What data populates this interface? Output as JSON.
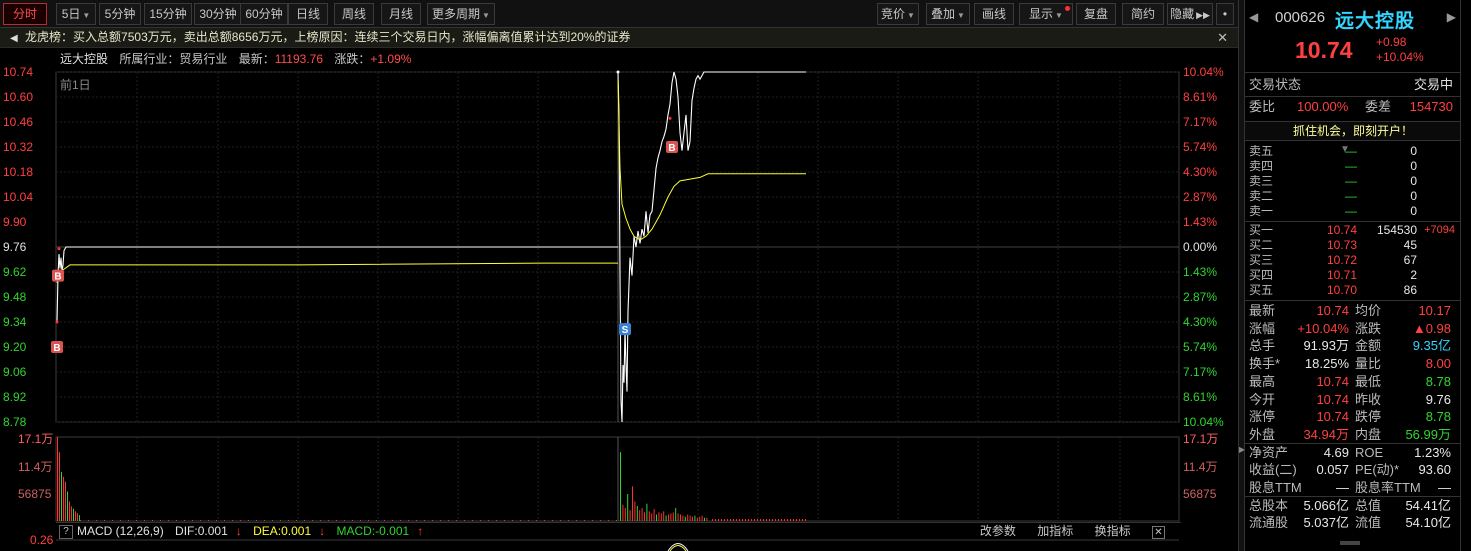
{
  "toolbar": {
    "left": [
      "分时",
      "5日",
      "5分钟",
      "15分钟",
      "30分钟",
      "60分钟",
      "日线",
      "周线",
      "月线",
      "更多周期"
    ],
    "right": [
      "竞价",
      "叠加",
      "画线",
      "显示",
      "复盘",
      "简约",
      "隐藏"
    ]
  },
  "notice": {
    "text": "龙虎榜：买入总额7503万元，卖出总额8656万元，上榜原因：连续三个交易日内，涨幅偏离值累计达到20%的证券",
    "close": "✕"
  },
  "chart_info": {
    "name": "远大控股",
    "industry": "所属行业：贸易行业",
    "latest_label": "最新：",
    "latest": "11193.76",
    "change_label": "涨跌：",
    "change": "+1.09%",
    "prev_label": "前1日"
  },
  "chart_data": {
    "type": "line",
    "price_ticks": [
      "10.74",
      "10.60",
      "10.46",
      "10.32",
      "10.18",
      "10.04",
      "9.90",
      "9.76",
      "9.62",
      "9.48",
      "9.34",
      "9.20",
      "9.06",
      "8.92",
      "8.78"
    ],
    "pct_ticks": [
      "10.04%",
      "8.61%",
      "7.17%",
      "5.74%",
      "4.30%",
      "2.87%",
      "1.43%",
      "0.00%",
      "1.43%",
      "2.87%",
      "4.30%",
      "5.74%",
      "7.17%",
      "8.61%",
      "10.04%"
    ],
    "prev_close": 9.76,
    "ylim": [
      8.78,
      10.74
    ],
    "volume_ticks": [
      "17.1万",
      "11.4万",
      "56875"
    ],
    "macd_tick": "0.26",
    "markers": [
      {
        "label": "B",
        "day": "prev",
        "price": 9.6
      },
      {
        "label": "B",
        "day": "prev",
        "price": 9.2
      },
      {
        "label": "S",
        "day": "today",
        "price": 9.3
      },
      {
        "label": "B",
        "day": "today",
        "price": 10.32
      }
    ],
    "series": [
      {
        "name": "price",
        "color": "#ffffff"
      },
      {
        "name": "avg",
        "color": "#ffff33"
      }
    ]
  },
  "macd": {
    "help": "?",
    "title": "MACD (12,26,9)",
    "dif": "DIF:0.001",
    "dea": "DEA:0.001",
    "macd": "MACD:-0.001",
    "actions": [
      "改参数",
      "加指标",
      "换指标"
    ],
    "close": "✕"
  },
  "panel": {
    "code": "000626",
    "name": "远大控股",
    "price": "10.74",
    "change": "+0.98",
    "change_pct": "+10.04%",
    "status_label": "交易状态",
    "status": "交易中",
    "weibi_label": "委比",
    "weibi": "100.00%",
    "weicha_label": "委差",
    "weicha": "154730",
    "promo": "抓住机会，即刻开户！",
    "sell": [
      {
        "label": "卖五",
        "price": "—",
        "vol": "0"
      },
      {
        "label": "卖四",
        "price": "—",
        "vol": "0"
      },
      {
        "label": "卖三",
        "price": "—",
        "vol": "0"
      },
      {
        "label": "卖二",
        "price": "—",
        "vol": "0"
      },
      {
        "label": "卖一",
        "price": "—",
        "vol": "0"
      }
    ],
    "buy": [
      {
        "label": "买一",
        "price": "10.74",
        "vol": "154530",
        "delta": "+7094"
      },
      {
        "label": "买二",
        "price": "10.73",
        "vol": "45",
        "delta": ""
      },
      {
        "label": "买三",
        "price": "10.72",
        "vol": "67",
        "delta": ""
      },
      {
        "label": "买四",
        "price": "10.71",
        "vol": "2",
        "delta": ""
      },
      {
        "label": "买五",
        "price": "10.70",
        "vol": "86",
        "delta": ""
      }
    ],
    "quotes": [
      {
        "a": "最新",
        "b": "10.74",
        "bc": "red",
        "c": "均价",
        "d": "10.17",
        "dc": "red"
      },
      {
        "a": "涨幅",
        "b": "+10.04%",
        "bc": "red",
        "c": "涨跌",
        "d": "▲0.98",
        "dc": "red"
      },
      {
        "a": "总手",
        "b": "91.93万",
        "bc": "white",
        "c": "金额",
        "d": "9.35亿",
        "dc": "cyan"
      },
      {
        "a": "换手*",
        "b": "18.25%",
        "bc": "white",
        "c": "量比",
        "d": "8.00",
        "dc": "red"
      },
      {
        "a": "最高",
        "b": "10.74",
        "bc": "red",
        "c": "最低",
        "d": "8.78",
        "dc": "green"
      },
      {
        "a": "今开",
        "b": "10.74",
        "bc": "red",
        "c": "昨收",
        "d": "9.76",
        "dc": "white"
      },
      {
        "a": "涨停",
        "b": "10.74",
        "bc": "red",
        "c": "跌停",
        "d": "8.78",
        "dc": "green"
      },
      {
        "a": "外盘",
        "b": "34.94万",
        "bc": "red",
        "c": "内盘",
        "d": "56.99万",
        "dc": "green"
      },
      {
        "a": "净资产",
        "b": "4.69",
        "bc": "white",
        "c": "ROE",
        "d": "1.23%",
        "dc": "white"
      },
      {
        "a": "收益(二)",
        "b": "0.057",
        "bc": "white",
        "c": "PE(动)*",
        "d": "93.60",
        "dc": "white"
      },
      {
        "a": "股息TTM",
        "b": "—",
        "bc": "white",
        "c": "股息率TTM",
        "d": "—",
        "dc": "white"
      },
      {
        "a": "总股本",
        "b": "5.066亿",
        "bc": "white",
        "c": "总值",
        "d": "54.41亿",
        "dc": "white"
      },
      {
        "a": "流通股",
        "b": "5.037亿",
        "bc": "white",
        "c": "流值",
        "d": "54.10亿",
        "dc": "white"
      }
    ]
  }
}
